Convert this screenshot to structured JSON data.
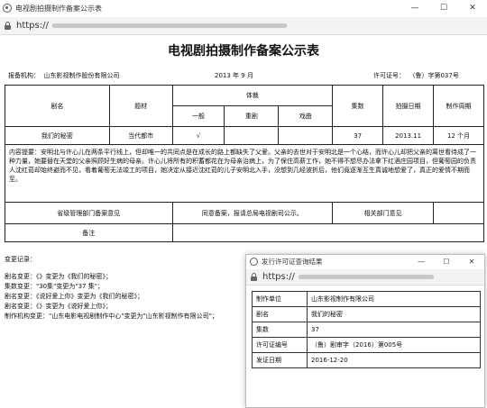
{
  "window": {
    "title": "电视剧拍摄制作备案公示表",
    "minimize_glyph": "—",
    "maximize_glyph": "☐",
    "close_glyph": "✕"
  },
  "address": {
    "scheme": "https://"
  },
  "doc": {
    "title": "电视剧拍摄制作备案公示表",
    "org_label": "报备机构：",
    "org_value": "山东影视制作股份有限公司",
    "date": "2013 年 9 月",
    "license_label": "许可证号：",
    "license_value": "（鲁）字第037号"
  },
  "table": {
    "headers": {
      "name": "剧名",
      "genre": "题材",
      "theme": "体裁",
      "sub_general": "一般",
      "sub_major": "重剧",
      "sub_opera": "戏曲",
      "episodes": "集数",
      "date": "拍摄日期",
      "period": "制作周期"
    },
    "row": {
      "name": "我们的秘密",
      "genre": "当代都市",
      "general": "√",
      "major": "",
      "opera": "",
      "episodes": "37",
      "date": "2013.11",
      "period": "12 个月"
    },
    "summary": "内容提要：安明北与许心儿在两条平行线上，但却唯一的共同点是在成长的路上都缺失了父爱。父亲的去世对于安明北是一个心结，而许心儿却把父亲的离世看待成了一种力量，她要替在天堂的父亲照顾好生病的母亲。许心儿将所有的积蓄都花在为母亲治病上，为了保住高薪工作，她不得不想尽办法拿下红酒庄园项目，但葡萄园的负责人沈红茹却始终避而不见，看着葡萄无法竣工的项目，她决定从接近沈红茹的儿子安明北入手，没想到几经波折后，他们竟逐渐互生真诚地想爱了，真正的爱情不期而至。",
    "opinion_label": "省级管理部门备案意见",
    "opinion_value": "同意备案，报请总局电视剧司公示。",
    "dept_label": "相关部门意见",
    "dept_value": "",
    "notes_label": "备注",
    "notes_value": ""
  },
  "changes": {
    "head": "变更记录：",
    "lines": [
      "剧名变更：《》变更为《我们的秘密》；",
      "集数变更：\"30集\"变更为\"37 集\"；",
      "剧名变更：《说好爱上你》变更为《我们的秘密》；",
      "剧名变更：《》变更为《说好爱上你》；",
      "制作机构变更：\"山东电影电视剧制作中心\"变更为\"山东影视制作有限公司\"；"
    ]
  },
  "popup": {
    "title": "发行许可证查询结果",
    "scheme": "https://",
    "rows": [
      {
        "key": "制作单位",
        "value": "山东影视制作有限公司"
      },
      {
        "key": "剧名",
        "value": "我们的秘密"
      },
      {
        "key": "集数",
        "value": "37"
      },
      {
        "key": "许可证编号",
        "value": "（鲁）剧审字（2016）第005号"
      },
      {
        "key": "发证日期",
        "value": "2016-12-20"
      }
    ]
  }
}
